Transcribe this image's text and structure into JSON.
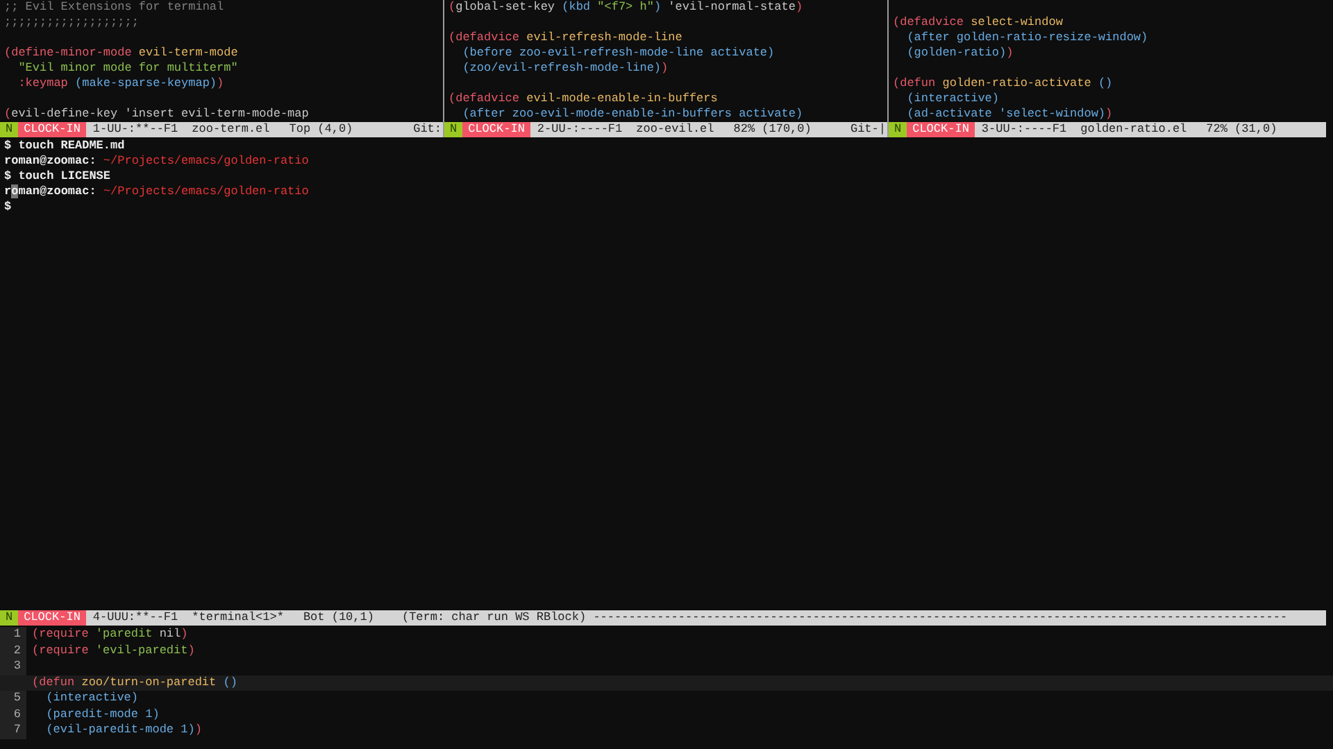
{
  "panes": [
    {
      "lines": [
        {
          "kind": "code",
          "segments": [
            {
              "kind": "comment",
              "text": ";; Evil Extensions for terminal"
            }
          ]
        },
        {
          "kind": "code",
          "segments": [
            {
              "kind": "comment",
              "text": ";;;;;;;;;;;;;;;;;;;"
            }
          ]
        },
        {
          "kind": "blank"
        },
        {
          "kind": "code",
          "segments": [
            {
              "kind": "kw",
              "text": "(define-minor-mode "
            },
            {
              "kind": "name",
              "text": "evil-term-mode"
            }
          ]
        },
        {
          "kind": "code",
          "segments": [
            {
              "kind": "str",
              "text": "  \"Evil minor mode for multiterm\""
            }
          ]
        },
        {
          "kind": "code",
          "segments": [
            {
              "kind": "kw",
              "text": "  :keymap "
            },
            {
              "kind": "blue",
              "text": "(make-sparse-keymap)"
            },
            {
              "kind": "kw",
              "text": ")"
            }
          ]
        },
        {
          "kind": "blank"
        },
        {
          "kind": "code",
          "segments": [
            {
              "kind": "kw",
              "text": "("
            },
            {
              "kind": "plain",
              "text": "evil-define-key 'insert evil-term-mode-map"
            }
          ]
        }
      ],
      "mode_line": {
        "state": "N",
        "badge": "CLOCK-IN",
        "status": "1-UU-:**--F1",
        "buffer": "zoo-term.el",
        "position": "Top (4,0)",
        "extra": "Git:"
      }
    },
    {
      "lines": [
        {
          "kind": "code",
          "segments": [
            {
              "kind": "kw",
              "text": "("
            },
            {
              "kind": "plain",
              "text": "global-set-key "
            },
            {
              "kind": "blue",
              "text": "(kbd "
            },
            {
              "kind": "str",
              "text": "\"<f7> h\""
            },
            {
              "kind": "blue",
              "text": ")"
            },
            {
              "kind": "plain",
              "text": " 'evil-normal-state"
            },
            {
              "kind": "kw",
              "text": ")"
            }
          ]
        },
        {
          "kind": "blank"
        },
        {
          "kind": "code",
          "segments": [
            {
              "kind": "kw",
              "text": "(defadvice "
            },
            {
              "kind": "name",
              "text": "evil-refresh-mode-line"
            }
          ]
        },
        {
          "kind": "code",
          "segments": [
            {
              "kind": "blue",
              "text": "  (before zoo-evil-refresh-mode-line activate)"
            }
          ]
        },
        {
          "kind": "code",
          "segments": [
            {
              "kind": "blue",
              "text": "  (zoo/evil-refresh-mode-line)"
            },
            {
              "kind": "kw",
              "text": ")"
            }
          ]
        },
        {
          "kind": "blank"
        },
        {
          "kind": "code",
          "segments": [
            {
              "kind": "kw",
              "text": "(defadvice "
            },
            {
              "kind": "name",
              "text": "evil-mode-enable-in-buffers"
            }
          ]
        },
        {
          "kind": "code",
          "segments": [
            {
              "kind": "blue",
              "text": "  (after zoo-evil-mode-enable-in-buffers activate)"
            }
          ]
        }
      ],
      "mode_line": {
        "state": "N",
        "badge": "CLOCK-IN",
        "status": "2-UU-:----F1",
        "buffer": "zoo-evil.el",
        "position": "82% (170,0)",
        "extra": "Git-|"
      }
    },
    {
      "lines": [
        {
          "kind": "blank"
        },
        {
          "kind": "code",
          "segments": [
            {
              "kind": "kw",
              "text": "(defadvice "
            },
            {
              "kind": "name",
              "text": "select-window"
            }
          ]
        },
        {
          "kind": "code",
          "segments": [
            {
              "kind": "blue",
              "text": "  (after golden-ratio-resize-window)"
            }
          ]
        },
        {
          "kind": "code",
          "segments": [
            {
              "kind": "blue",
              "text": "  (golden-ratio)"
            },
            {
              "kind": "kw",
              "text": ")"
            }
          ]
        },
        {
          "kind": "blank"
        },
        {
          "kind": "code",
          "segments": [
            {
              "kind": "kw",
              "text": "(defun "
            },
            {
              "kind": "name",
              "text": "golden-ratio-activate "
            },
            {
              "kind": "blue",
              "text": "()"
            }
          ]
        },
        {
          "kind": "code",
          "segments": [
            {
              "kind": "blue",
              "text": "  (interactive)"
            }
          ]
        },
        {
          "kind": "code",
          "segments": [
            {
              "kind": "blue",
              "text": "  (ad-activate 'select-window)"
            },
            {
              "kind": "kw",
              "text": ")"
            }
          ]
        }
      ],
      "mode_line": {
        "state": "N",
        "badge": "CLOCK-IN",
        "status": "3-UU-:----F1",
        "buffer": "golden-ratio.el",
        "position": "72% (31,0)"
      }
    }
  ],
  "terminal": {
    "lines": [
      {
        "segments": [
          {
            "kind": "prompt",
            "text": "$ touch README.md"
          }
        ]
      },
      {
        "segments": [
          {
            "kind": "prompt",
            "text": "roman@zoomac: "
          },
          {
            "kind": "path",
            "text": "~/Projects/emacs/golden-ratio"
          }
        ]
      },
      {
        "segments": [
          {
            "kind": "prompt",
            "text": "$ touch LICENSE"
          }
        ]
      },
      {
        "segments": [
          {
            "kind": "prompt",
            "text": "r"
          },
          {
            "kind": "cursor",
            "text": "o"
          },
          {
            "kind": "prompt",
            "text": "man@zoomac: "
          },
          {
            "kind": "path",
            "text": "~/Projects/emacs/golden-ratio"
          }
        ]
      },
      {
        "segments": [
          {
            "kind": "prompt",
            "text": "$"
          }
        ]
      }
    ],
    "mode_line": {
      "state": "N",
      "badge": "CLOCK-IN",
      "status": "4-UUU:**--F1",
      "buffer": "*terminal<1>*",
      "position": "Bot (10,1)",
      "extra": "(Term: char run WS RBlock) --------------------------------------------------------------------------------------------------"
    }
  },
  "editor": {
    "lines": [
      {
        "number": "1",
        "current": false,
        "segments": [
          {
            "kind": "kw",
            "text": "(require "
          },
          {
            "kind": "str",
            "text": "'paredit"
          },
          {
            "kind": "plain",
            "text": " nil"
          },
          {
            "kind": "kw",
            "text": ")"
          }
        ]
      },
      {
        "number": "2",
        "current": false,
        "segments": [
          {
            "kind": "kw",
            "text": "(require "
          },
          {
            "kind": "str",
            "text": "'evil-paredit"
          },
          {
            "kind": "kw",
            "text": ")"
          }
        ]
      },
      {
        "number": "3",
        "current": false
      },
      {
        "current": true,
        "segments": [
          {
            "kind": "kw",
            "text": "(defun "
          },
          {
            "kind": "name",
            "text": "zoo/turn-on-paredit "
          },
          {
            "kind": "blue",
            "text": "()"
          }
        ]
      },
      {
        "number": "5",
        "current": false,
        "segments": [
          {
            "kind": "blue",
            "text": "  (interactive)"
          }
        ]
      },
      {
        "number": "6",
        "current": false,
        "segments": [
          {
            "kind": "blue",
            "text": "  (paredit-mode 1)"
          }
        ]
      },
      {
        "number": "7",
        "current": false,
        "segments": [
          {
            "kind": "blue",
            "text": "  (evil-paredit-mode 1)"
          },
          {
            "kind": "kw",
            "text": ")"
          }
        ]
      }
    ]
  }
}
